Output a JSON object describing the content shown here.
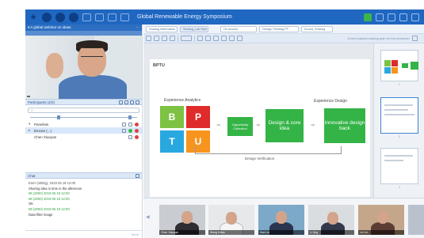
{
  "window": {
    "title": "Global Renewable Energy Symposium",
    "colors": {
      "titlebar": "#1f67c0",
      "accent": "#3bb54a",
      "alert": "#e04040"
    }
  },
  "left_panel": {
    "header": "▾ A global webinar on ideas",
    "video_label": "",
    "participants": {
      "title": "Participants (2/2)",
      "rows": [
        {
          "name": "Panelists",
          "caret": "▾"
        },
        {
          "name": "Emcee (...)",
          "caret": "▸"
        },
        {
          "name": "Chen Xiaoyan",
          "caret": ""
        }
      ]
    },
    "chat": {
      "title": "Chat",
      "messages": [
        {
          "meta": "Emm (Wittig), 2019 05 19 12:00",
          "text": "Sharing idea in time in the afternoon",
          "green": false
        },
        {
          "meta": "Mt (2000) 2019 05 19 12:00",
          "text": "",
          "green": true
        },
        {
          "meta": "Mt (2000) 2019 05 19 12:00",
          "text": "OK",
          "green": true
        },
        {
          "meta": "Mt (2000) 2019 05 19 12:00",
          "text": "Data filter image",
          "green": true
        }
      ],
      "send_label": "Send"
    }
  },
  "toolbar": {
    "tabs": [
      "Sharing information",
      "Sharing_Lab.Pptx",
      "On Access",
      "Design Thinking.PT",
      "Sound_Sharing"
    ],
    "right_text": "Current global sharing plan for the presenter"
  },
  "slide": {
    "title": "BPTU",
    "experience_analytics": "Experience Analytics",
    "experience_design": "Experience Design",
    "blocks": {
      "b": "B",
      "p": "P",
      "t": "T",
      "u": "U",
      "opportunity": "Opportunity Collection",
      "design": "Design & core idea",
      "innovative": "Innovative design back"
    },
    "design_verification": "Design Verification"
  },
  "thumbnails": {
    "numbers": [
      "1",
      "2",
      "3"
    ]
  },
  "video_strip": {
    "tiles": [
      {
        "caption": "Chen Xiaoyan"
      },
      {
        "caption": "Wong Ketan"
      },
      {
        "caption": "Hue Lin"
      },
      {
        "caption": "Li Jing"
      },
      {
        "caption": "Lei Lin"
      }
    ]
  }
}
